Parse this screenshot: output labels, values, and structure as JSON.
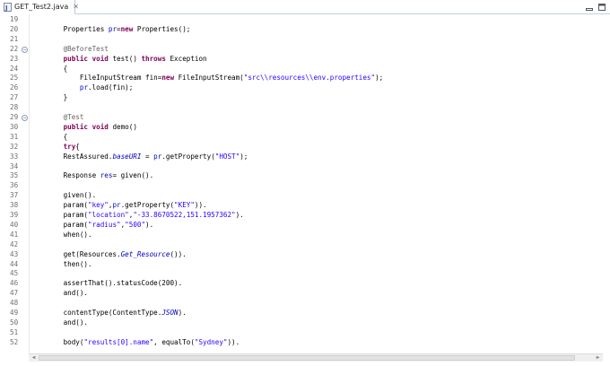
{
  "tab": {
    "label": "GET_Test2.java",
    "close_icon": "close-icon",
    "file_icon": "java-file-icon"
  },
  "window_buttons": [
    "minimize-icon",
    "maximize-icon"
  ],
  "colors": {
    "keyword": "#7f0055",
    "string": "#2a00ff",
    "annotation": "#646464",
    "field": "#0000c0",
    "line_number": "#6e6e6e"
  },
  "lines": [
    {
      "num": "19",
      "tokens": []
    },
    {
      "num": "20",
      "tokens": [
        {
          "t": "        Properties ",
          "c": "plain"
        },
        {
          "t": "pr",
          "c": "var"
        },
        {
          "t": "=",
          "c": "plain"
        },
        {
          "t": "new",
          "c": "kw"
        },
        {
          "t": " Properties();",
          "c": "plain"
        }
      ]
    },
    {
      "num": "21",
      "tokens": []
    },
    {
      "num": "22",
      "fold": true,
      "tokens": [
        {
          "t": "        @BeforeTest",
          "c": "ann"
        }
      ]
    },
    {
      "num": "23",
      "tokens": [
        {
          "t": "        ",
          "c": "plain"
        },
        {
          "t": "public",
          "c": "kw"
        },
        {
          "t": " ",
          "c": "plain"
        },
        {
          "t": "void",
          "c": "kw"
        },
        {
          "t": " test() ",
          "c": "plain"
        },
        {
          "t": "throws",
          "c": "kw"
        },
        {
          "t": " Exception",
          "c": "plain"
        }
      ]
    },
    {
      "num": "24",
      "tokens": [
        {
          "t": "        {",
          "c": "plain"
        }
      ]
    },
    {
      "num": "25",
      "tokens": [
        {
          "t": "            FileInputStream fin=",
          "c": "plain"
        },
        {
          "t": "new",
          "c": "kw"
        },
        {
          "t": " FileInputStream(",
          "c": "plain"
        },
        {
          "t": "\"src\\\\resources\\\\env.properties\"",
          "c": "str"
        },
        {
          "t": ");",
          "c": "plain"
        }
      ]
    },
    {
      "num": "26",
      "tokens": [
        {
          "t": "            ",
          "c": "plain"
        },
        {
          "t": "pr",
          "c": "var"
        },
        {
          "t": ".load(fin);",
          "c": "plain"
        }
      ]
    },
    {
      "num": "27",
      "tokens": [
        {
          "t": "        }",
          "c": "plain"
        }
      ]
    },
    {
      "num": "28",
      "tokens": []
    },
    {
      "num": "29",
      "fold": true,
      "tokens": [
        {
          "t": "        @Test",
          "c": "ann"
        }
      ]
    },
    {
      "num": "30",
      "tokens": [
        {
          "t": "        ",
          "c": "plain"
        },
        {
          "t": "public",
          "c": "kw"
        },
        {
          "t": " ",
          "c": "plain"
        },
        {
          "t": "void",
          "c": "kw"
        },
        {
          "t": " demo()",
          "c": "plain"
        }
      ]
    },
    {
      "num": "31",
      "tokens": [
        {
          "t": "        {",
          "c": "plain"
        }
      ]
    },
    {
      "num": "32",
      "tokens": [
        {
          "t": "        ",
          "c": "plain"
        },
        {
          "t": "try",
          "c": "kw"
        },
        {
          "t": "{",
          "c": "plain"
        }
      ]
    },
    {
      "num": "33",
      "tokens": [
        {
          "t": "        RestAssured.",
          "c": "plain"
        },
        {
          "t": "baseURI",
          "c": "ital"
        },
        {
          "t": " = ",
          "c": "plain"
        },
        {
          "t": "pr",
          "c": "var"
        },
        {
          "t": ".getProperty(",
          "c": "plain"
        },
        {
          "t": "\"HOST\"",
          "c": "str"
        },
        {
          "t": ");",
          "c": "plain"
        }
      ]
    },
    {
      "num": "34",
      "tokens": []
    },
    {
      "num": "35",
      "tokens": [
        {
          "t": "        Response ",
          "c": "plain"
        },
        {
          "t": "res",
          "c": "var"
        },
        {
          "t": "= given().",
          "c": "plain"
        }
      ]
    },
    {
      "num": "36",
      "tokens": []
    },
    {
      "num": "37",
      "tokens": [
        {
          "t": "        given().",
          "c": "plain"
        }
      ]
    },
    {
      "num": "38",
      "tokens": [
        {
          "t": "        param(",
          "c": "plain"
        },
        {
          "t": "\"key\"",
          "c": "str"
        },
        {
          "t": ",",
          "c": "plain"
        },
        {
          "t": "pr",
          "c": "var"
        },
        {
          "t": ".getProperty(",
          "c": "plain"
        },
        {
          "t": "\"KEY\"",
          "c": "str"
        },
        {
          "t": ")).",
          "c": "plain"
        }
      ]
    },
    {
      "num": "39",
      "tokens": [
        {
          "t": "        param(",
          "c": "plain"
        },
        {
          "t": "\"location\"",
          "c": "str"
        },
        {
          "t": ",",
          "c": "plain"
        },
        {
          "t": "\"-33.8670522,151.1957362\"",
          "c": "str"
        },
        {
          "t": ").",
          "c": "plain"
        }
      ]
    },
    {
      "num": "40",
      "tokens": [
        {
          "t": "        param(",
          "c": "plain"
        },
        {
          "t": "\"radius\"",
          "c": "str"
        },
        {
          "t": ",",
          "c": "plain"
        },
        {
          "t": "\"500\"",
          "c": "str"
        },
        {
          "t": ").",
          "c": "plain"
        }
      ]
    },
    {
      "num": "41",
      "tokens": [
        {
          "t": "        when().",
          "c": "plain"
        }
      ]
    },
    {
      "num": "42",
      "tokens": []
    },
    {
      "num": "43",
      "tokens": [
        {
          "t": "        get(Resources.",
          "c": "plain"
        },
        {
          "t": "Get_Resource",
          "c": "ital"
        },
        {
          "t": "()).",
          "c": "plain"
        }
      ]
    },
    {
      "num": "44",
      "tokens": [
        {
          "t": "        then().",
          "c": "plain"
        }
      ]
    },
    {
      "num": "45",
      "tokens": []
    },
    {
      "num": "46",
      "tokens": [
        {
          "t": "        assertThat().statusCode(200).",
          "c": "plain"
        }
      ]
    },
    {
      "num": "47",
      "tokens": [
        {
          "t": "        and().",
          "c": "plain"
        }
      ]
    },
    {
      "num": "48",
      "tokens": []
    },
    {
      "num": "49",
      "tokens": [
        {
          "t": "        contentType(ContentType.",
          "c": "plain"
        },
        {
          "t": "JSON",
          "c": "ital"
        },
        {
          "t": ").",
          "c": "plain"
        }
      ]
    },
    {
      "num": "50",
      "tokens": [
        {
          "t": "        and().",
          "c": "plain"
        }
      ]
    },
    {
      "num": "51",
      "tokens": []
    },
    {
      "num": "52",
      "tokens": [
        {
          "t": "        body(",
          "c": "plain"
        },
        {
          "t": "\"results[0].name\"",
          "c": "str"
        },
        {
          "t": ", equalTo(",
          "c": "plain"
        },
        {
          "t": "\"Sydney\"",
          "c": "str"
        },
        {
          "t": ")).",
          "c": "plain"
        }
      ]
    }
  ]
}
